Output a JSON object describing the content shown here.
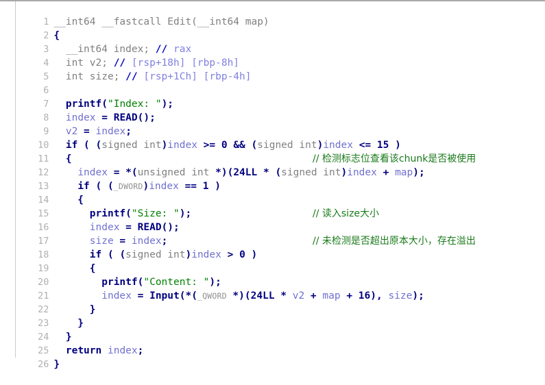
{
  "view": {
    "name": "ida-pseudocode",
    "background": "#ffffff",
    "gutter_color": "#b0b0b0",
    "total_lines": 26
  },
  "colors": {
    "plain": "#808080",
    "keyword": "#000080",
    "local_var": "#7070d0",
    "string": "#008000",
    "comment": "#1a7a1a",
    "register_ref": "#8080e0",
    "line_number": "#b0b0b0"
  },
  "lines": [
    {
      "n": "1",
      "text": "__int64 __fastcall Edit(__int64 map)"
    },
    {
      "n": "2",
      "text": "{"
    },
    {
      "n": "3",
      "text": "  __int64 index; // rax"
    },
    {
      "n": "4",
      "text": "  int v2; // [rsp+18h] [rbp-8h]"
    },
    {
      "n": "5",
      "text": "  int size; // [rsp+1Ch] [rbp-4h]"
    },
    {
      "n": "6",
      "text": ""
    },
    {
      "n": "7",
      "text": "  printf(\"Index: \");"
    },
    {
      "n": "8",
      "text": "  index = READ();"
    },
    {
      "n": "9",
      "text": "  v2 = index;"
    },
    {
      "n": "10",
      "text": "  if ( (signed int)index >= 0 && (signed int)index <= 15 )"
    },
    {
      "n": "11",
      "text": "  {"
    },
    {
      "n": "12",
      "text": "    index = *(unsigned int *)(24LL * (signed int)index + map);"
    },
    {
      "n": "13",
      "text": "    if ( (_DWORD)index == 1 )"
    },
    {
      "n": "14",
      "text": "    {"
    },
    {
      "n": "15",
      "text": "      printf(\"Size: \");"
    },
    {
      "n": "16",
      "text": "      index = READ();"
    },
    {
      "n": "17",
      "text": "      size = index;"
    },
    {
      "n": "18",
      "text": "      if ( (signed int)index > 0 )"
    },
    {
      "n": "19",
      "text": "      {"
    },
    {
      "n": "20",
      "text": "        printf(\"Content: \");"
    },
    {
      "n": "21",
      "text": "        index = Input(*(_QWORD *)(24LL * v2 + map + 16), size);"
    },
    {
      "n": "22",
      "text": "      }"
    },
    {
      "n": "23",
      "text": "    }"
    },
    {
      "n": "24",
      "text": "  }"
    },
    {
      "n": "25",
      "text": "  return index;"
    },
    {
      "n": "26",
      "text": "}"
    }
  ],
  "comments": {
    "line13": "// 检测标志位查看该chunk是否被使用",
    "line16": "// 读入size大小",
    "line18": "// 未检测是否超出原本大小，存在溢出"
  },
  "decl_comments": {
    "line3": "// rax",
    "line4": "// [rsp+18h] [rbp-8h]",
    "line5": "// [rsp+1Ch] [rbp-4h]"
  },
  "strings": {
    "index_prompt": "\"Index: \"",
    "size_prompt": "\"Size: \"",
    "content_prompt": "\"Content: \""
  },
  "function": {
    "return_type": "__int64",
    "calling_convention": "__fastcall",
    "name": "Edit",
    "parameter": "__int64 map"
  },
  "locals": [
    {
      "type": "__int64",
      "name": "index",
      "location": "rax"
    },
    {
      "type": "int",
      "name": "v2",
      "location": "[rsp+18h] [rbp-8h]"
    },
    {
      "type": "int",
      "name": "size",
      "location": "[rsp+1Ch] [rbp-4h]"
    }
  ],
  "tokens": {
    "l1_a": "__int64 __fastcall Edit(__int64 map)",
    "l2_a": "{",
    "l3_a": "  __int64 index; ",
    "l3_b": "// ",
    "l3_c": "rax",
    "l4_a": "  int v2; ",
    "l4_b": "// ",
    "l4_c": "[rsp+18h] [rbp-8h]",
    "l5_a": "  int size; ",
    "l5_b": "// ",
    "l5_c": "[rsp+1Ch] [rbp-4h]",
    "l7_a": "  ",
    "l7_b": "printf",
    "l7_c": "(",
    "l7_d": "\"Index: \"",
    "l7_e": ");",
    "l8_a": "  ",
    "l8_b": "index",
    "l8_c": " = ",
    "l8_d": "READ",
    "l8_e": "();",
    "l9_a": "  ",
    "l9_b": "v2",
    "l9_c": " = ",
    "l9_d": "index",
    "l9_e": ";",
    "l10_a": "  ",
    "l10_b": "if",
    "l10_c": " ( (",
    "l10_d": "signed int",
    "l10_e": ")",
    "l10_f": "index",
    "l10_g": " >= 0 && (",
    "l10_h": "signed int",
    "l10_i": ")",
    "l10_j": "index",
    "l10_k": " <= 15 )",
    "l11_a": "  {",
    "l12_a": "    ",
    "l12_b": "index",
    "l12_c": " = *(",
    "l12_d": "unsigned int ",
    "l12_e": "*)(",
    "l12_f": "24LL * ",
    "l12_g": "(",
    "l12_h": "signed int",
    "l12_i": ")",
    "l12_j": "index",
    "l12_k": " + ",
    "l12_l": "map",
    "l12_m": ");",
    "l13_a": "    ",
    "l13_b": "if",
    "l13_c": " ( (",
    "l13_d": "_DWORD",
    "l13_e": ")",
    "l13_f": "index",
    "l13_g": " == 1 )",
    "l14_a": "    {",
    "l15_a": "      ",
    "l15_b": "printf",
    "l15_c": "(",
    "l15_d": "\"Size: \"",
    "l15_e": ");",
    "l16_a": "      ",
    "l16_b": "index",
    "l16_c": " = ",
    "l16_d": "READ",
    "l16_e": "();",
    "l17_a": "      ",
    "l17_b": "size",
    "l17_c": " = ",
    "l17_d": "index",
    "l17_e": ";",
    "l18_a": "      ",
    "l18_b": "if",
    "l18_c": " ( (",
    "l18_d": "signed int",
    "l18_e": ")",
    "l18_f": "index",
    "l18_g": " > 0 )",
    "l19_a": "      {",
    "l20_a": "        ",
    "l20_b": "printf",
    "l20_c": "(",
    "l20_d": "\"Content: \"",
    "l20_e": ");",
    "l21_a": "        ",
    "l21_b": "index",
    "l21_c": " = ",
    "l21_d": "Input",
    "l21_e": "(*(",
    "l21_f": "_QWORD",
    "l21_g": " *)(",
    "l21_h": "24LL * ",
    "l21_i": "v2",
    "l21_j": " + ",
    "l21_k": "map",
    "l21_l": " + 16), ",
    "l21_m": "size",
    "l21_n": ");",
    "l22_a": "      }",
    "l23_a": "    }",
    "l24_a": "  }",
    "l25_a": "  ",
    "l25_b": "return",
    "l25_c": " ",
    "l25_d": "index",
    "l25_e": ";",
    "l26_a": "}"
  }
}
